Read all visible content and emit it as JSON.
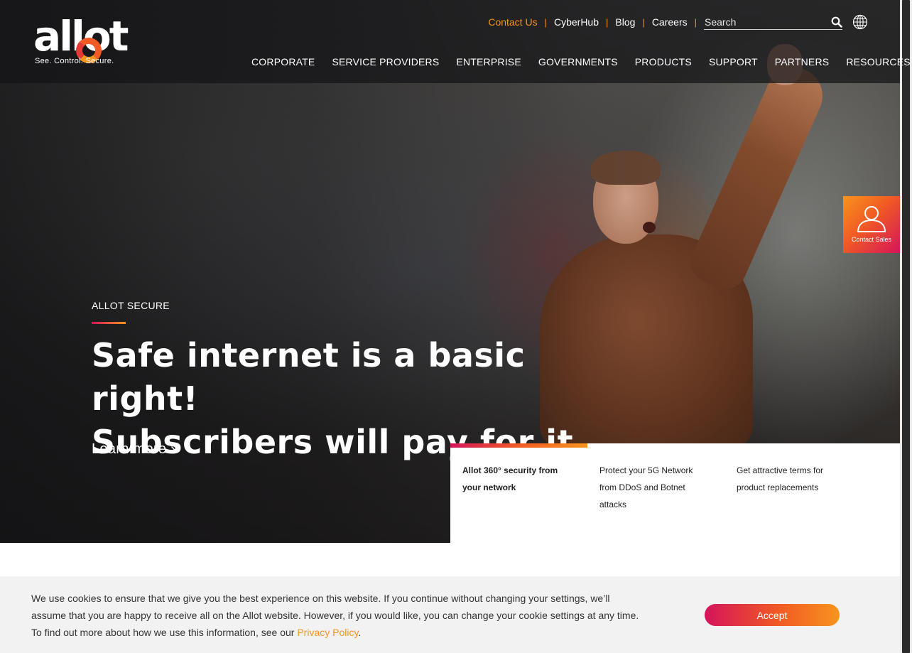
{
  "brand": {
    "logo_text": "allot",
    "tagline": "See. Control. Secure.",
    "accent_colors": [
      "#d4145a",
      "#f15a24",
      "#f7941d"
    ]
  },
  "utility_nav": {
    "items": [
      {
        "label": "Contact Us",
        "active": true
      },
      {
        "label": "CyberHub"
      },
      {
        "label": "Blog"
      },
      {
        "label": "Careers"
      }
    ],
    "separator": "|",
    "search": {
      "placeholder": "Search",
      "value": "",
      "icon": "search-icon"
    },
    "language_icon": "globe-icon"
  },
  "main_nav": {
    "items": [
      {
        "label": "CORPORATE"
      },
      {
        "label": "SERVICE PROVIDERS"
      },
      {
        "label": "ENTERPRISE"
      },
      {
        "label": "GOVERNMENTS"
      },
      {
        "label": "PRODUCTS"
      },
      {
        "label": "SUPPORT"
      },
      {
        "label": "PARTNERS"
      },
      {
        "label": "RESOURCES"
      }
    ]
  },
  "hero": {
    "eyebrow": "ALLOT SECURE",
    "headline_line1": "Safe internet is a basic right!",
    "headline_line2": "Subscribers will pay for it.",
    "cta": "Learn more »"
  },
  "feature_tabs": {
    "items": [
      {
        "label": "Allot 360° security from your network",
        "active": true
      },
      {
        "label": "Protect your 5G Network from DDoS and Botnet attacks"
      },
      {
        "label": "Get attractive terms for product replacements"
      }
    ]
  },
  "contact_sales": {
    "label": "Contact Sales",
    "icon": "user-icon"
  },
  "cookie_banner": {
    "text": "We use cookies to ensure that we give you the best experience on this website. If you continue without changing your settings, we’ll assume that you are happy to receive all on the Allot website. However, if you would like, you can change your cookie settings at any time. To find out more about how we use this information, see our ",
    "link_label": "Privacy Policy",
    "text_end": ".",
    "accept_label": "Accept"
  }
}
